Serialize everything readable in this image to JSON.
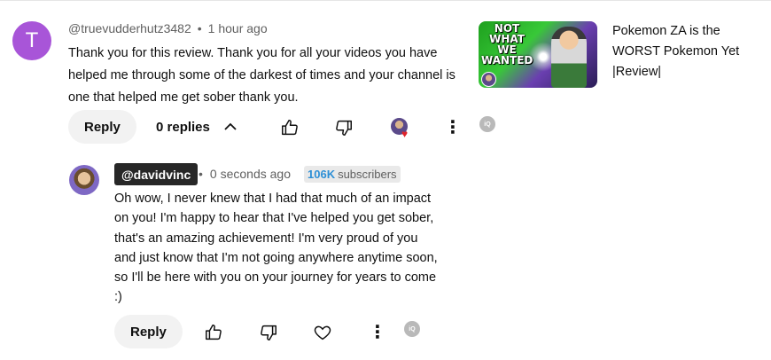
{
  "comment": {
    "avatar_letter": "T",
    "author": "@truevudderhutz3482",
    "time": "1 hour ago",
    "text": "Thank you for this review. Thank you for all your videos you have helped me through some of the darkest of times and your channel is one that helped me get sober thank you.",
    "reply_label": "Reply",
    "replies_label": "0 replies"
  },
  "video": {
    "thumbnail_text": "NOT WHAT WE WANTED",
    "title": "Pokemon ZA is the WORST Pokemon Yet |Review|"
  },
  "reply": {
    "author": "@davidvinc",
    "time": "0 seconds ago",
    "subscribers_count": "106K",
    "subscribers_label": "subscribers",
    "text": "Oh wow, I never knew that I had that much of an impact on you! I'm happy to hear that I've helped you get sober, that's an amazing achievement! I'm very proud of you and just know that I'm not going anywhere anytime soon, so I'll be here with you on your journey for years to come :)",
    "reply_label": "Reply"
  },
  "icons": {
    "more": "⋮",
    "extension_badge": "iQ",
    "separator": "•"
  },
  "colors": {
    "avatar": "#a855d8",
    "subscribers_accent": "#2d8fd6",
    "heart": "#e0242b"
  }
}
